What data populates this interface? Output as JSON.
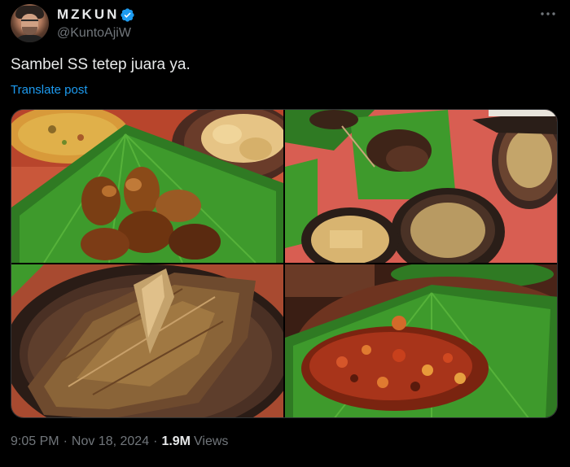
{
  "author": {
    "display_name": "MZKUN",
    "handle": "@KuntoAjiW",
    "verified": true
  },
  "post": {
    "text": "Sambel SS tetep juara ya.",
    "translate_label": "Translate post"
  },
  "media": {
    "photo_count": 4,
    "photos": [
      "fried-food-on-banana-leaf",
      "grilled-skewers-and-anchovies",
      "fried-fish-on-clay-plate",
      "sambal-on-banana-leaf"
    ]
  },
  "meta": {
    "time": "9:05 PM",
    "separator": "·",
    "date": "Nov 18, 2024",
    "views_count": "1.9M",
    "views_label": "Views"
  },
  "colors": {
    "background": "#000000",
    "text_primary": "#e7e9ea",
    "text_secondary": "#71767b",
    "link": "#1d9bf0",
    "verified": "#1d9bf0",
    "border": "#2f3336"
  },
  "icons": {
    "verified": "verified-badge-icon",
    "more": "more-horizontal-icon"
  }
}
